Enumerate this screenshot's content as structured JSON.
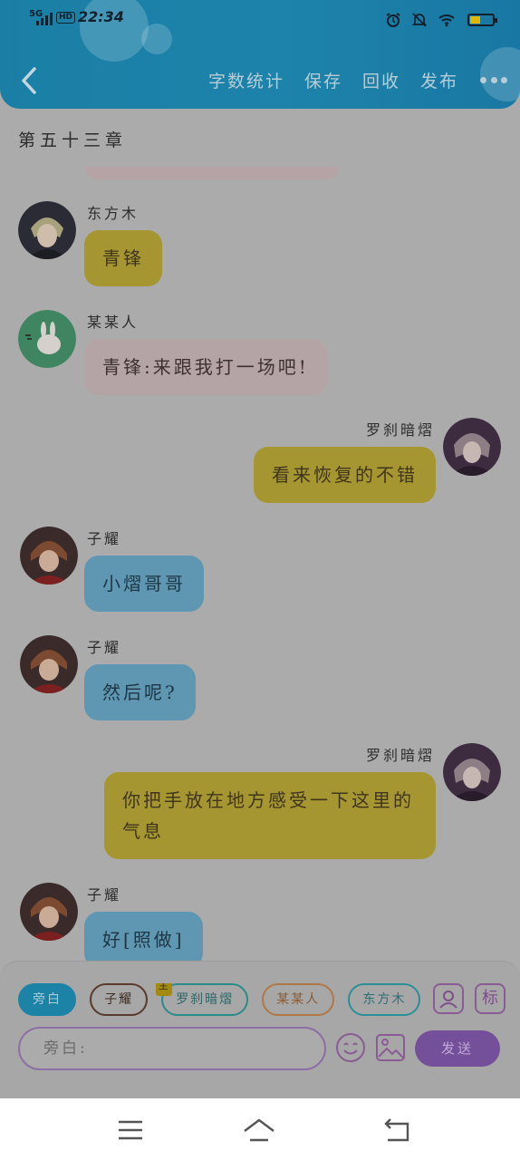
{
  "status_bar": {
    "network": "5G",
    "hd": "HD",
    "time": "22:34",
    "battery_level": 0.45,
    "battery_color": "#e0b700"
  },
  "header": {
    "back_icon": "chevron-left-icon",
    "menu": [
      "字数统计",
      "保存",
      "回收",
      "发布"
    ],
    "more_icon": "more-horizontal-icon"
  },
  "chapter": {
    "title": "第五十三章"
  },
  "messages": [
    {
      "sender": "东方木",
      "text": "青锋",
      "side": "left",
      "color": "yellow"
    },
    {
      "sender": "某某人",
      "text": "青锋:来跟我打一场吧!",
      "side": "left",
      "color": "pink"
    },
    {
      "sender": "罗刹暗熠",
      "text": "看来恢复的不错",
      "side": "right",
      "color": "yellow"
    },
    {
      "sender": "子耀",
      "text": "小熠哥哥",
      "side": "left",
      "color": "blue"
    },
    {
      "sender": "子耀",
      "text": "然后呢?",
      "side": "left",
      "color": "blue"
    },
    {
      "sender": "罗刹暗熠",
      "text": "你把手放在地方感受一下这里的气息",
      "side": "right",
      "color": "yellow"
    },
    {
      "sender": "子耀",
      "text": "好[照做]",
      "side": "left",
      "color": "blue"
    }
  ],
  "input_panel": {
    "roles": [
      {
        "label": "旁白",
        "active": true
      },
      {
        "label": "子耀",
        "active": false
      },
      {
        "label": "罗刹暗熠",
        "active": false,
        "badge": "主"
      },
      {
        "label": "某某人",
        "active": false
      },
      {
        "label": "东方木",
        "active": false
      }
    ],
    "portrait_icon": "person-portrait-icon",
    "mark_label": "标",
    "placeholder": "旁白:",
    "emoji_icon": "smiley-icon",
    "image_icon": "image-icon",
    "send_label": "发送"
  },
  "colors": {
    "header": "#1b7fa5",
    "bubble_yellow": "#a69632",
    "bubble_pink": "#b4a4a5",
    "bubble_blue": "#5f97b3",
    "send": "#744f9a"
  },
  "system_nav": [
    "menu-icon",
    "home-icon",
    "back-icon"
  ]
}
